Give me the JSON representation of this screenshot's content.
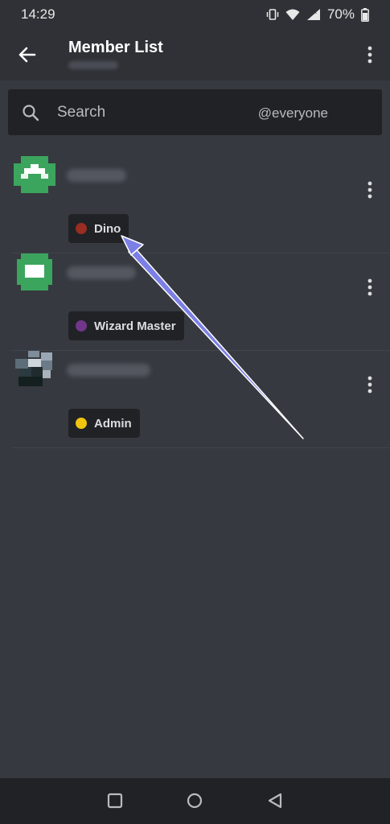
{
  "status_bar": {
    "time": "14:29",
    "battery": "70%"
  },
  "header": {
    "title": "Member List",
    "back_icon": "arrow-left-icon",
    "more_icon": "more-vertical-icon"
  },
  "search": {
    "placeholder": "Search",
    "scope": "@everyone",
    "icon": "search-icon"
  },
  "members": [
    {
      "name_hidden": true,
      "role": "Dino",
      "role_color": "#992d22",
      "avatar_color": "#3ba55d"
    },
    {
      "name_hidden": true,
      "role": "Wizard Master",
      "role_color": "#71368a",
      "avatar_color": "#3ba55d"
    },
    {
      "name_hidden": true,
      "role": "Admin",
      "role_color": "#f1c40f",
      "avatar_color": "#7f8c9a"
    }
  ],
  "annotation": {
    "type": "arrow",
    "color": "#7b7fe6"
  },
  "nav_bar": {
    "buttons": [
      "recent-apps-icon",
      "home-icon",
      "back-triangle-icon"
    ]
  }
}
